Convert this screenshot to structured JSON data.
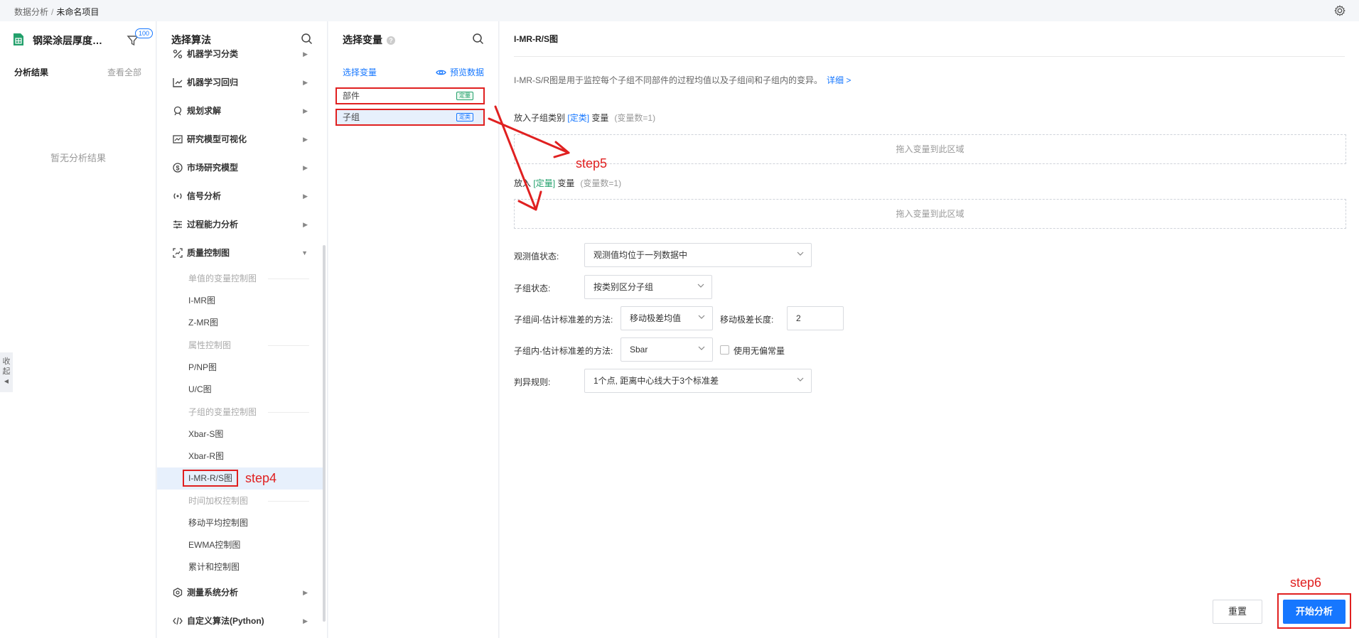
{
  "breadcrumb": {
    "root": "数据分析",
    "sep": "/",
    "current": "未命名项目"
  },
  "left": {
    "file_name": "钢梁涂层厚度…",
    "filter_badge": "100",
    "results_title": "分析结果",
    "view_all": "查看全部",
    "empty": "暂无分析结果",
    "collapse": [
      "收",
      "起"
    ]
  },
  "algo": {
    "title": "选择算法",
    "categories": [
      {
        "label": "机器学习分类",
        "icon": "percent-icon"
      },
      {
        "label": "机器学习回归",
        "icon": "chart-icon"
      },
      {
        "label": "规划求解",
        "icon": "solve-icon"
      },
      {
        "label": "研究模型可视化",
        "icon": "trend-icon"
      },
      {
        "label": "市场研究模型",
        "icon": "dollar-icon"
      },
      {
        "label": "信号分析",
        "icon": "signal-icon"
      },
      {
        "label": "过程能力分析",
        "icon": "sliders-icon"
      },
      {
        "label": "质量控制图",
        "icon": "scan-icon"
      }
    ],
    "groups": {
      "single": "单值的变量控制图",
      "attr": "属性控制图",
      "subgroup": "子组的变量控制图",
      "time": "时间加权控制图"
    },
    "items": {
      "imr": "I-MR图",
      "zmr": "Z-MR图",
      "pnp": "P/NP图",
      "uc": "U/C图",
      "xbars": "Xbar-S图",
      "xbarr": "Xbar-R图",
      "imrrs": "I-MR-R/S图",
      "ma": "移动平均控制图",
      "ewma": "EWMA控制图",
      "cusum": "累计和控制图"
    },
    "bottom_categories": [
      {
        "label": "测量系统分析",
        "icon": "measure-icon"
      },
      {
        "label": "自定义算法(Python)",
        "icon": "code-icon"
      }
    ]
  },
  "vars": {
    "title": "选择变量",
    "tab": "选择变量",
    "preview": "预览数据",
    "items": [
      {
        "name": "部件",
        "tag": "定量"
      },
      {
        "name": "子组",
        "tag": "定类"
      }
    ]
  },
  "config": {
    "title": "I-MR-R/S图",
    "desc": "I-MR-S/R图是用于监控每个子组不同部件的过程均值以及子组间和子组内的变异。",
    "desc_link": "详细 >",
    "slot1": {
      "pre": "放入子组类别",
      "type": "[定类]",
      "post": "变量",
      "count": "(变量数=1)"
    },
    "slot2": {
      "pre": "放入",
      "type": "[定量]",
      "post": "变量",
      "count": "(变量数=1)"
    },
    "drop_hint": "拖入变量到此区域",
    "obs_label": "观测值状态:",
    "obs_value": "观测值均位于一列数据中",
    "subgroup_label": "子组状态:",
    "subgroup_value": "按类别区分子组",
    "between_label": "子组间-估计标准差的方法:",
    "between_value": "移动极差均值",
    "mr_len_label": "移动极差长度:",
    "mr_len_value": "2",
    "within_label": "子组内-估计标准差的方法:",
    "within_value": "Sbar",
    "unbiased_label": "使用无偏常量",
    "rule_label": "判异规则:",
    "rule_value": "1个点, 距离中心线大于3个标准差",
    "reset": "重置",
    "start": "开始分析"
  },
  "annotations": {
    "step4": "step4",
    "step5": "step5",
    "step6": "step6"
  },
  "colors": {
    "accent": "#1677ff",
    "annotation": "#e02020",
    "quant": "#22a06b"
  }
}
